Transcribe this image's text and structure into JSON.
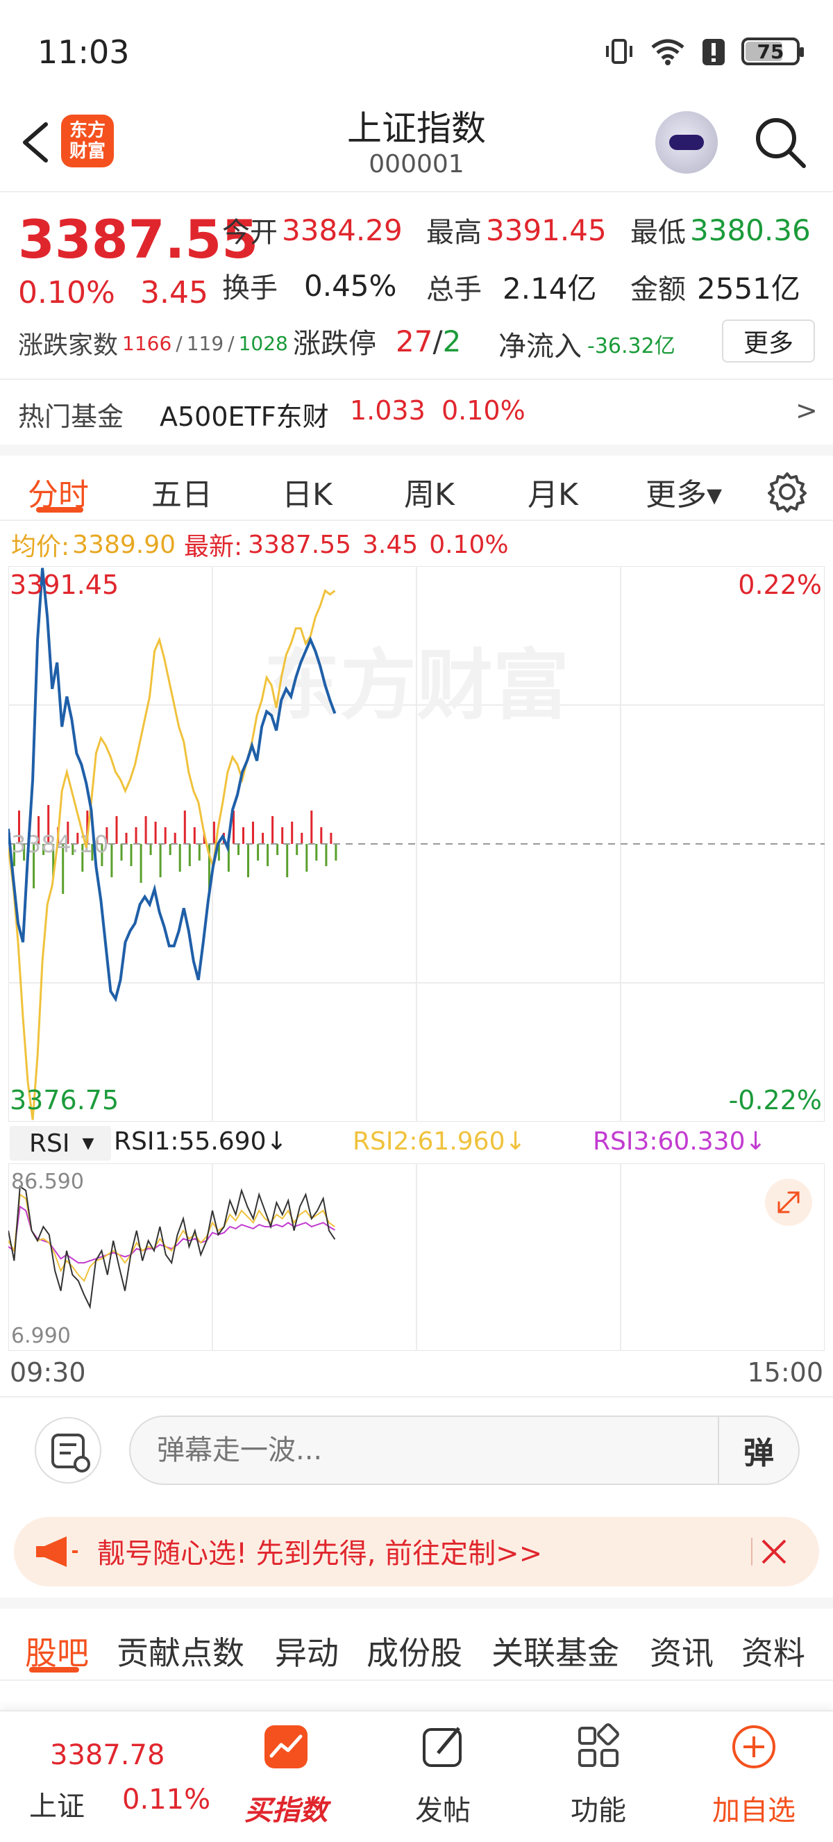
{
  "status_bar": {
    "time": "11:03",
    "battery": "75"
  },
  "header": {
    "logo_text": "东方财富",
    "title": "上证指数",
    "code": "000001"
  },
  "quote": {
    "price": "3387.55",
    "change_pct": "0.10%",
    "change_abs": "3.45",
    "open_label": "今开",
    "open": "3384.29",
    "high_label": "最高",
    "high": "3391.45",
    "low_label": "最低",
    "low": "3380.36",
    "turnover_label": "换手",
    "turnover": "0.45%",
    "volume_label": "总手",
    "volume": "2.14亿",
    "amount_label": "金额",
    "amount": "2551亿",
    "breadth_label": "涨跌家数",
    "up": "1166",
    "flat": "119",
    "down": "1028",
    "limit_label": "涨跌停",
    "limit_up": "27",
    "limit_down": "2",
    "netflow_label": "净流入",
    "netflow": "-36.32亿",
    "more_label": "更多"
  },
  "hot_fund": {
    "label": "热门基金",
    "name": "A500ETF东财",
    "price": "1.033",
    "pct": "0.10%",
    "arrow": ">"
  },
  "chart_tabs": [
    {
      "label": "分时",
      "active": true
    },
    {
      "label": "五日",
      "active": false
    },
    {
      "label": "日K",
      "active": false
    },
    {
      "label": "周K",
      "active": false
    },
    {
      "label": "月K",
      "active": false
    },
    {
      "label": "更多▾",
      "active": false
    }
  ],
  "info_line": {
    "avg_label": "均价:",
    "avg": "3389.90",
    "latest_label": "最新:",
    "latest": "3387.55",
    "latest_abs": "3.45",
    "latest_pct": "0.10%"
  },
  "main_chart": {
    "y_max": "3391.45",
    "y_min": "3376.75",
    "pct_max": "0.22%",
    "pct_min": "-0.22%",
    "prev_close": "3384.10",
    "watermark": "东方财富",
    "colors": {
      "price": "#1f5fa8",
      "avg": "#f0c23c",
      "up": "#e0262d",
      "down": "#5aa02c"
    }
  },
  "rsi": {
    "selector": "RSI",
    "rsi1": "RSI1:55.690↓",
    "rsi2": "RSI2:61.960↓",
    "rsi3": "RSI3:60.330↓",
    "y_max": "86.590",
    "y_min": "6.990"
  },
  "time_axis": {
    "start": "09:30",
    "end": "15:00"
  },
  "danmaku": {
    "placeholder": "弹幕走一波...",
    "toggle": "弹"
  },
  "promo": {
    "text": "靓号随心选! 先到先得, 前往定制>>"
  },
  "section_tabs": [
    {
      "label": "股吧",
      "active": true
    },
    {
      "label": "贡献点数",
      "active": false
    },
    {
      "label": "异动",
      "active": false
    },
    {
      "label": "成份股",
      "active": false
    },
    {
      "label": "关联基金",
      "active": false
    },
    {
      "label": "资讯",
      "active": false
    },
    {
      "label": "资料",
      "active": false
    }
  ],
  "bottom_nav": {
    "index_value": "3387.78",
    "index_name": "上证",
    "index_pct": "0.11%",
    "buy_label": "买指数",
    "post_label": "发帖",
    "func_label": "功能",
    "add_label": "加自选"
  },
  "chart_data": [
    {
      "type": "line",
      "title": "",
      "xlabel": "",
      "ylabel": "",
      "ylim": [
        3376.75,
        3391.45
      ],
      "x_range": [
        "09:30",
        "15:00"
      ],
      "series": [
        {
          "values": [
            3384.5,
            3383.2,
            3382.0,
            3381.5,
            3383.8,
            3385.8,
            3389.5,
            3391.4,
            3390.1,
            3388.2,
            3388.9,
            3387.2,
            3388.0,
            3387.4,
            3386.5,
            3386.2,
            3385.7,
            3385.0,
            3383.5,
            3382.6,
            3381.4,
            3380.2,
            3380.0,
            3380.5,
            3381.5,
            3381.8,
            3382.0,
            3382.5,
            3382.7,
            3382.5,
            3382.9,
            3382.3,
            3381.9,
            3381.4,
            3381.4,
            3381.8,
            3382.4,
            3381.8,
            3381.0,
            3380.5,
            3381.5,
            3382.6,
            3383.5,
            3384.1,
            3384.3,
            3384.0,
            3385.0,
            3385.4,
            3386.0,
            3386.3,
            3386.7,
            3386.3,
            3387.2,
            3387.6,
            3387.5,
            3387.1,
            3387.9,
            3388.2,
            3388.0,
            3388.5,
            3388.9,
            3389.2,
            3389.5,
            3389.2,
            3388.8,
            3388.3,
            3387.9,
            3387.55
          ]
        },
        {
          "values": [
            3384.0,
            3383.0,
            3381.5,
            3379.5,
            3377.8,
            3376.8,
            3378.5,
            3381.0,
            3382.5,
            3383.0,
            3384.0,
            3385.5,
            3386.0,
            3385.5,
            3385.0,
            3384.5,
            3384.0,
            3385.2,
            3386.5,
            3386.9,
            3386.7,
            3386.4,
            3386.0,
            3385.8,
            3385.5,
            3385.8,
            3386.2,
            3386.8,
            3387.4,
            3388.0,
            3389.2,
            3389.5,
            3389.0,
            3388.4,
            3387.8,
            3387.2,
            3386.8,
            3386.0,
            3385.5,
            3385.2,
            3384.5,
            3383.9,
            3383.5,
            3384.5,
            3385.2,
            3386.0,
            3386.4,
            3386.2,
            3385.8,
            3386.3,
            3386.8,
            3387.5,
            3387.9,
            3388.5,
            3388.3,
            3387.7,
            3388.5,
            3389.1,
            3389.4,
            3389.8,
            3389.8,
            3389.4,
            3389.6,
            3390.1,
            3390.4,
            3390.8,
            3390.7,
            3390.8
          ]
        },
        {
          "values": [
            2,
            -4,
            6,
            -3,
            2,
            -8,
            5,
            -2,
            7,
            -6,
            3,
            -9,
            4,
            -2,
            2,
            -5,
            6,
            -3,
            1,
            -4,
            3,
            -6,
            5,
            -3,
            2,
            -4,
            3,
            -7,
            5,
            -2,
            4,
            -6,
            3,
            -2,
            2,
            -5,
            6,
            -4,
            3,
            -3,
            2,
            -9,
            4,
            -3,
            2,
            -5,
            6,
            -2,
            3,
            -6,
            4,
            -3,
            2,
            -4,
            5,
            -2,
            3,
            -6,
            4,
            -2,
            2,
            -5,
            6,
            -3,
            3,
            -4,
            2,
            -3
          ]
        }
      ]
    },
    {
      "type": "line",
      "title": "RSI",
      "ylim": [
        6.99,
        86.59
      ],
      "series": [
        {
          "name": "RSI1",
          "values": [
            60,
            45,
            82,
            80,
            60,
            55,
            62,
            58,
            40,
            30,
            50,
            38,
            35,
            28,
            22,
            45,
            50,
            38,
            55,
            42,
            30,
            48,
            60,
            45,
            55,
            50,
            62,
            48,
            44,
            58,
            66,
            52,
            60,
            48,
            55,
            70,
            58,
            62,
            75,
            68,
            80,
            72,
            66,
            78,
            70,
            62,
            74,
            68,
            75,
            60,
            72,
            78,
            66,
            70,
            76,
            60,
            55.69
          ]
        },
        {
          "name": "RSI2",
          "values": [
            55,
            50,
            78,
            76,
            60,
            55,
            56,
            54,
            48,
            40,
            45,
            42,
            38,
            35,
            42,
            45,
            46,
            48,
            50,
            48,
            44,
            48,
            54,
            50,
            52,
            51,
            56,
            52,
            50,
            55,
            60,
            56,
            58,
            54,
            57,
            64,
            60,
            62,
            68,
            65,
            70,
            67,
            64,
            70,
            66,
            64,
            68,
            66,
            70,
            64,
            68,
            70,
            66,
            68,
            70,
            64,
            61.96
          ]
        },
        {
          "name": "RSI3",
          "values": [
            52,
            50,
            72,
            70,
            60,
            56,
            55,
            54,
            50,
            46,
            48,
            46,
            44,
            44,
            45,
            46,
            47,
            48,
            49,
            48,
            47,
            48,
            51,
            50,
            51,
            51,
            53,
            52,
            51,
            53,
            56,
            55,
            56,
            54,
            55,
            59,
            58,
            59,
            62,
            61,
            63,
            62,
            61,
            63,
            62,
            62,
            63,
            62,
            64,
            62,
            63,
            64,
            62,
            63,
            64,
            62,
            60.33
          ]
        }
      ]
    }
  ]
}
